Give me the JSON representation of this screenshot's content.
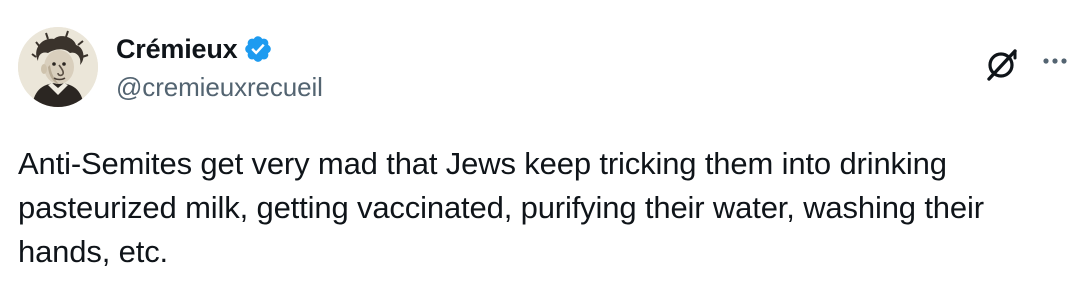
{
  "author": {
    "display_name": "Crémieux",
    "handle": "@cremieuxrecueil",
    "verified": true,
    "avatar_icon": "caricature-portrait-avatar",
    "verified_icon": "verified-badge-icon",
    "verified_color": "#1d9bf0"
  },
  "actions": {
    "grok_icon": "grok-icon",
    "more_icon": "more-options-icon"
  },
  "tweet": {
    "text": "Anti-Semites get very mad that Jews keep tricking them into drinking pasteurized milk, getting vaccinated, purifying their water, washing their hands, etc."
  },
  "colors": {
    "primary_text": "#0f1419",
    "secondary_text": "#536471",
    "background": "#ffffff"
  }
}
